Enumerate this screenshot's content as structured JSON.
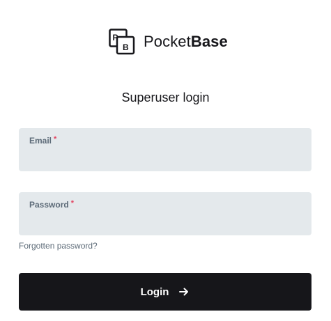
{
  "brand": {
    "logo_letters": [
      "P",
      "B"
    ],
    "name_regular": "Pocket",
    "name_bold": "Base",
    "logo_icon": "pocketbase-logo-icon"
  },
  "title": "Superuser login",
  "form": {
    "email": {
      "label": "Email",
      "required_marker": "*",
      "value": "",
      "placeholder": ""
    },
    "password": {
      "label": "Password",
      "required_marker": "*",
      "value": "",
      "placeholder": ""
    },
    "forgot_link": "Forgotten password?",
    "submit": {
      "label": "Login",
      "icon": "arrow-right-icon"
    }
  },
  "colors": {
    "primary": "#16161a",
    "field_bg": "#e4e9ec",
    "label": "#5d6b78",
    "required": "#e34562"
  }
}
